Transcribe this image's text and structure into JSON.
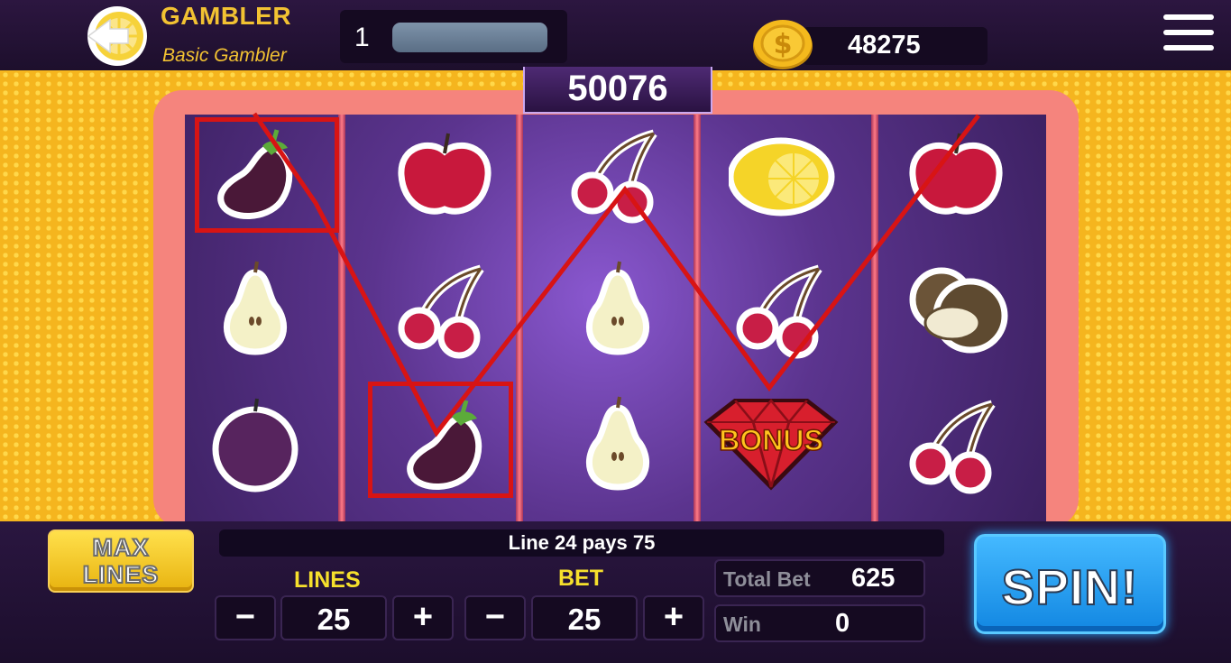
{
  "header": {
    "title": "GAMBLER",
    "subtitle": "Basic Gambler",
    "level": "1",
    "xp_progress": 0.0,
    "coins": "48275",
    "icons": {
      "back": "lemon-back-icon",
      "coin": "dollar-coin-icon",
      "menu": "hamburger-menu-icon"
    }
  },
  "jackpot": "50076",
  "reels": [
    [
      "eggplant",
      "pear",
      "plum"
    ],
    [
      "apple",
      "cherry",
      "eggplant"
    ],
    [
      "cherry",
      "pear",
      "pear"
    ],
    [
      "lemon",
      "cherry",
      "bonus"
    ],
    [
      "apple",
      "coconut",
      "cherry"
    ]
  ],
  "bonus_label": "BONUS",
  "winning_cells": [
    [
      0,
      0
    ],
    [
      1,
      2
    ]
  ],
  "message": "Line 24 pays 75",
  "controls": {
    "max_lines_top": "MAX",
    "max_lines_bottom": "LINES",
    "lines_label": "LINES",
    "lines_value": "25",
    "bet_label": "BET",
    "bet_value": "25",
    "minus": "−",
    "plus": "+",
    "total_bet_label": "Total Bet",
    "total_bet_value": "625",
    "win_label": "Win",
    "win_value": "0",
    "spin_label": "SPIN!"
  },
  "colors": {
    "gold": "#f2c232",
    "payline": "#d81414",
    "spin": "#1f9cf0",
    "background_yellow": "#f5b51e",
    "frame": "#f5847d"
  }
}
